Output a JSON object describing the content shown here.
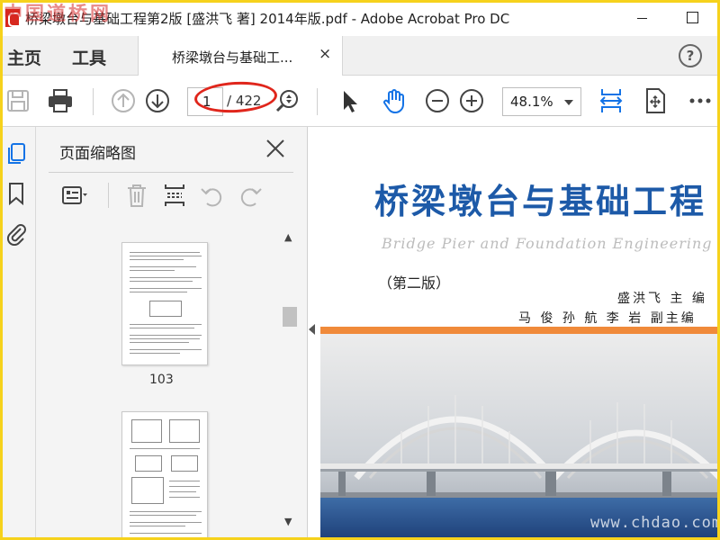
{
  "window": {
    "title": "桥梁墩台与基础工程第2版 [盛洪飞 著] 2014年版.pdf - Adobe Acrobat Pro DC",
    "watermark": "中国道桥网"
  },
  "menubar": {
    "home_label": "主页",
    "tools_label": "工具",
    "doc_tab_label": "桥梁墩台与基础工...",
    "doc_tab_close": "×",
    "help_symbol": "?"
  },
  "toolbar": {
    "current_page": "1",
    "total_pages": "/ 422",
    "zoom_value": "48.1%",
    "icons": [
      "save-icon",
      "print-icon",
      "prev-page-icon",
      "next-page-icon",
      "zoom-marquee-icon",
      "select-arrow-icon",
      "hand-tool-icon",
      "zoom-out-icon",
      "zoom-in-icon",
      "fit-width-icon",
      "scroll-mode-icon",
      "more-icon"
    ]
  },
  "panel": {
    "title": "页面缩略图",
    "thumbnails": [
      {
        "label": "103"
      }
    ]
  },
  "document": {
    "title": "桥梁墩台与基础工程",
    "subtitle": "Bridge Pier and Foundation Engineering",
    "edition": "（第二版）",
    "editor": "盛洪飞  主  编",
    "coeditors": "马 俊 孙 航 李 岩  副主编",
    "watermark": "www.chdao.com"
  },
  "colors": {
    "accent_blue": "#1473e6",
    "title_blue": "#1d5aa8",
    "annotation_red": "#e0261c",
    "frame_yellow": "#f6d21c"
  }
}
